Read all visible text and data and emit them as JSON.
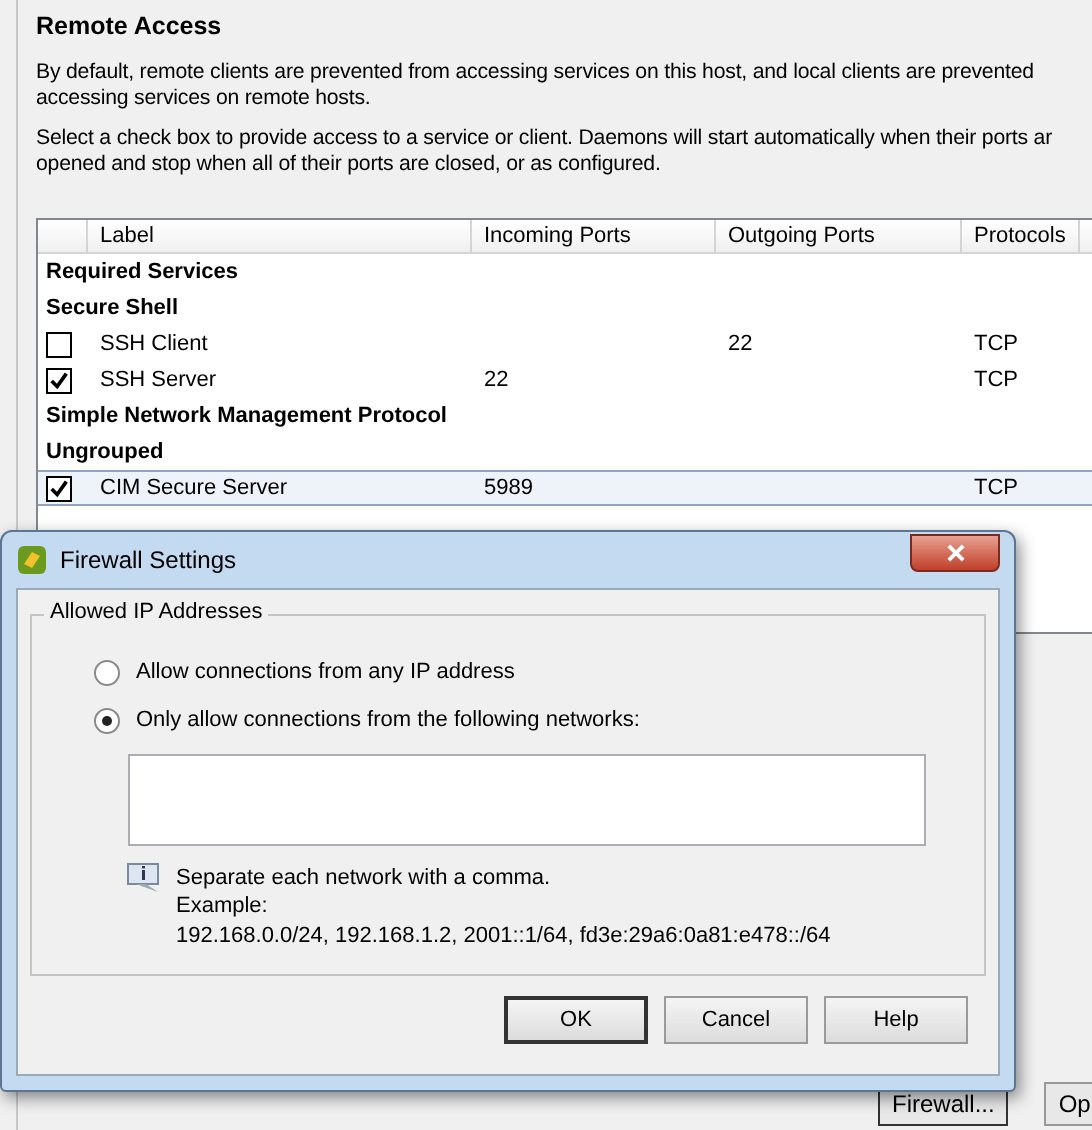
{
  "panel": {
    "title": "Remote Access",
    "paragraphs": [
      [
        "By default, remote clients are prevented from accessing services on this host, and local clients are prevented",
        "accessing services on remote hosts."
      ],
      [
        "Select a check box to provide access to a service or client. Daemons will start automatically when their ports ar",
        "opened and stop when all of their ports are closed, or as configured."
      ]
    ]
  },
  "table": {
    "columns": [
      "Label",
      "Incoming Ports",
      "Outgoing Ports",
      "Protocols"
    ],
    "rows": [
      {
        "kind": "group",
        "label": "Required Services"
      },
      {
        "kind": "group",
        "label": "Secure Shell"
      },
      {
        "kind": "item",
        "checked": false,
        "selected": false,
        "label": "SSH Client",
        "outgoing": "22",
        "protocol": "TCP"
      },
      {
        "kind": "item",
        "checked": true,
        "selected": false,
        "label": "SSH Server",
        "incoming": "22",
        "protocol": "TCP"
      },
      {
        "kind": "group",
        "label": "Simple Network Management Protocol"
      },
      {
        "kind": "group",
        "label": "Ungrouped"
      },
      {
        "kind": "item",
        "checked": true,
        "selected": true,
        "label": "CIM Secure Server",
        "incoming": "5989",
        "protocol": "TCP"
      }
    ]
  },
  "panel_buttons": [
    "Firewall...",
    "Op"
  ],
  "dialog": {
    "title": "Firewall Settings",
    "group_title": "Allowed IP Addresses",
    "options": [
      {
        "label": "Allow connections from any IP address",
        "selected": false
      },
      {
        "label": "Only allow connections from the following networks:",
        "selected": true
      }
    ],
    "hint": "Separate each network with a comma.",
    "example_label": "Example:",
    "example": "192.168.0.0/24, 192.168.1.2, 2001::1/64, fd3e:29a6:0a81:e478::/64",
    "buttons": [
      {
        "label": "OK",
        "default": true
      },
      {
        "label": "Cancel",
        "default": false
      },
      {
        "label": "Help",
        "default": false
      }
    ]
  }
}
